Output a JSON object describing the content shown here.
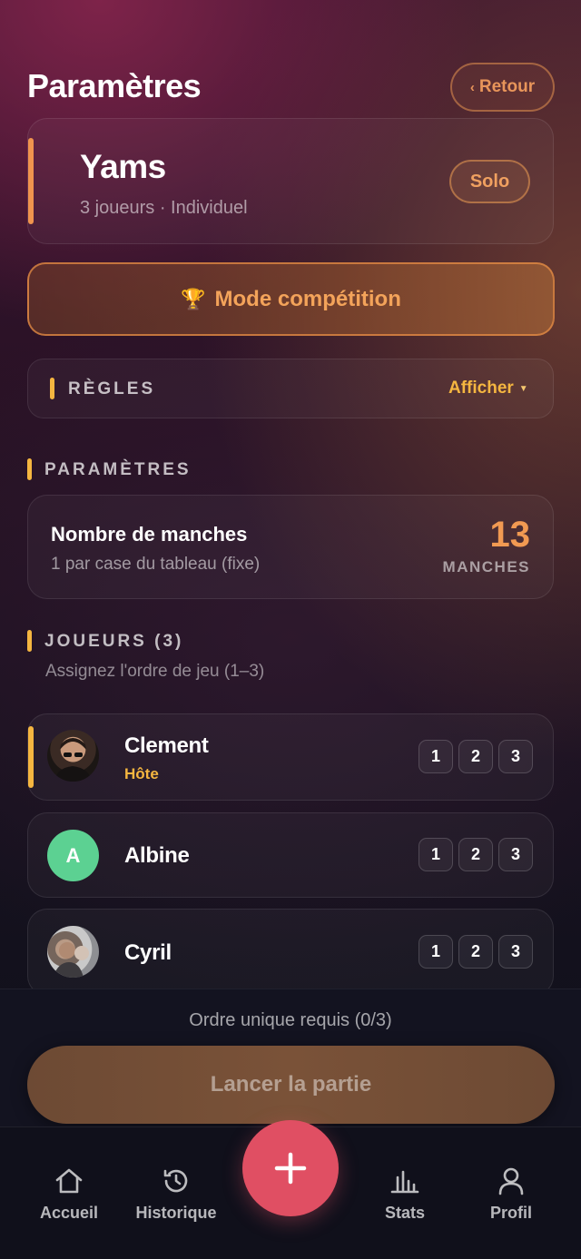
{
  "header": {
    "title": "Paramètres",
    "back_label": "Retour"
  },
  "game": {
    "name": "Yams",
    "subtitle": "3 joueurs · Individuel",
    "mode_badge": "Solo"
  },
  "competition_button": "Mode compétition",
  "rules": {
    "label": "RÈGLES",
    "toggle_label": "Afficher"
  },
  "settings": {
    "section_label": "PARAMÈTRES",
    "rounds": {
      "title": "Nombre de manches",
      "subtitle": "1 par case du tableau (fixe)",
      "value": "13",
      "unit": "MANCHES"
    }
  },
  "players": {
    "section_label": "JOUEURS (3)",
    "subtitle": "Assignez l'ordre de jeu (1–3)",
    "list": [
      {
        "name": "Clement",
        "tag": "Hôte",
        "avatar": "photo-avatar",
        "orders": [
          "1",
          "2",
          "3"
        ]
      },
      {
        "name": "Albine",
        "avatar_letter": "A",
        "avatar_color": "#5cd192",
        "orders": [
          "1",
          "2",
          "3"
        ]
      },
      {
        "name": "Cyril",
        "avatar": "photo-avatar",
        "orders": [
          "1",
          "2",
          "3"
        ]
      }
    ]
  },
  "footer": {
    "order_status": "Ordre unique requis (0/3)",
    "launch_label": "Lancer la partie"
  },
  "nav": {
    "items": [
      {
        "label": "Accueil",
        "icon": "home-icon"
      },
      {
        "label": "Historique",
        "icon": "history-icon"
      },
      {
        "label": "Stats",
        "icon": "stats-icon"
      },
      {
        "label": "Profil",
        "icon": "profile-icon"
      }
    ],
    "fab_icon": "plus-icon"
  },
  "colors": {
    "accent": "#f0944e",
    "gold": "#f5b640",
    "fab": "#e04f63",
    "avatar_green": "#5cd192"
  }
}
